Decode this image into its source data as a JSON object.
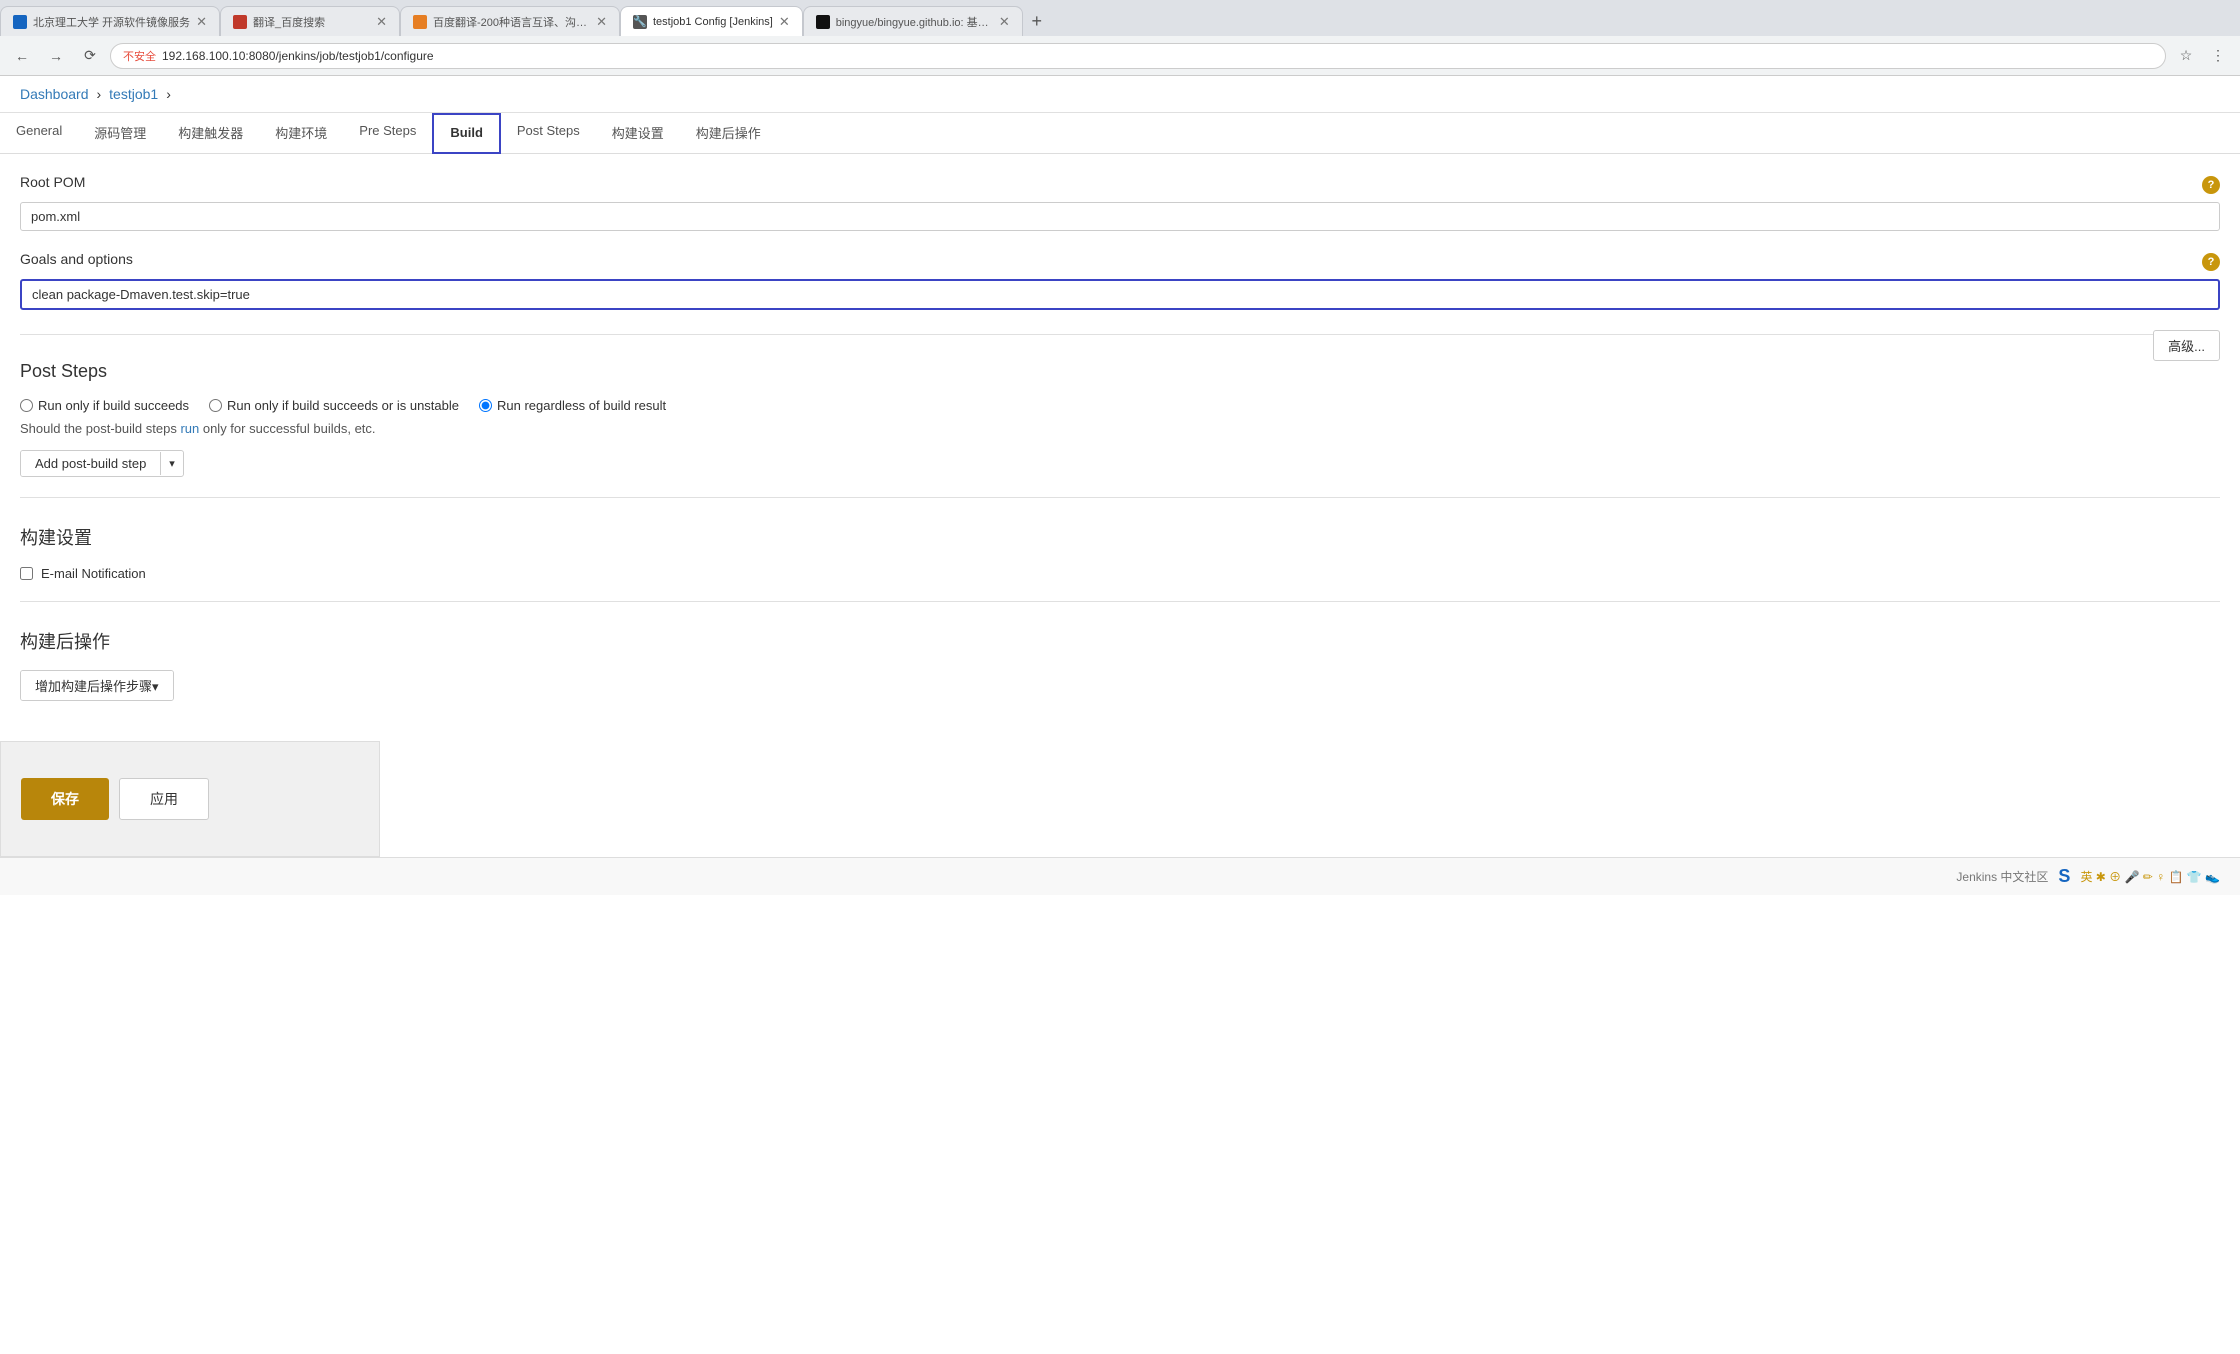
{
  "browser": {
    "tabs": [
      {
        "id": "tab1",
        "title": "北京理工大学 开源软件镜像服务",
        "favicon_color": "#1565C0",
        "active": false
      },
      {
        "id": "tab2",
        "title": "翻译_百度搜索",
        "favicon_color": "#c0392b",
        "active": false
      },
      {
        "id": "tab3",
        "title": "百度翻译-200种语言互译、沟通...",
        "favicon_color": "#e67e22",
        "active": false
      },
      {
        "id": "tab4",
        "title": "testjob1 Config [Jenkins]",
        "favicon_color": "#555",
        "active": true
      },
      {
        "id": "tab5",
        "title": "bingyue/bingyue.github.io: 基于...",
        "favicon_color": "#111",
        "active": false
      }
    ],
    "url": "192.168.100.10:8080/jenkins/job/testjob1/configure",
    "security_warning": "不安全"
  },
  "breadcrumb": {
    "dashboard": "Dashboard",
    "sep1": "›",
    "job": "testjob1",
    "sep2": "›"
  },
  "config_tabs": [
    {
      "id": "general",
      "label": "General",
      "active": false
    },
    {
      "id": "source",
      "label": "源码管理",
      "active": false
    },
    {
      "id": "triggers",
      "label": "构建触发器",
      "active": false
    },
    {
      "id": "env",
      "label": "构建环境",
      "active": false
    },
    {
      "id": "pre-steps",
      "label": "Pre Steps",
      "active": false
    },
    {
      "id": "build",
      "label": "Build",
      "active": true
    },
    {
      "id": "post-steps",
      "label": "Post Steps",
      "active": false
    },
    {
      "id": "build-settings",
      "label": "构建设置",
      "active": false
    },
    {
      "id": "post-build",
      "label": "构建后操作",
      "active": false
    }
  ],
  "root_pom": {
    "label": "Root POM",
    "value": "pom.xml"
  },
  "goals_options": {
    "label": "Goals and options",
    "value": "clean package-Dmaven.test.skip=true",
    "link_text": "Dmaven.test.skip"
  },
  "advanced_btn": "高级...",
  "post_steps": {
    "title": "Post Steps",
    "radio_options": [
      {
        "id": "run_success",
        "label": "Run only if build succeeds",
        "checked": false
      },
      {
        "id": "run_success_unstable",
        "label": "Run only if build succeeds or is unstable",
        "checked": false
      },
      {
        "id": "run_regardless",
        "label": "Run regardless of build result",
        "checked": true
      }
    ],
    "description": "Should the post-build steps run only for successful builds, etc.",
    "add_btn": "Add post-build step"
  },
  "build_settings": {
    "title": "构建设置",
    "email_notification": {
      "label": "E-mail Notification",
      "checked": false
    }
  },
  "post_build": {
    "title": "构建后操作",
    "add_btn": "增加构建后操作步骤▾"
  },
  "buttons": {
    "save": "保存",
    "apply": "应用"
  },
  "footer": {
    "text": "Jenkins 中文社区"
  }
}
